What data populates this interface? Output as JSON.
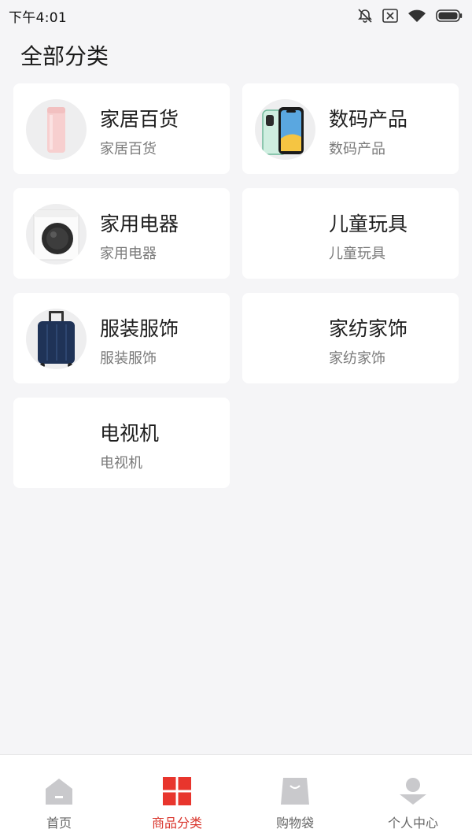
{
  "status_bar": {
    "time": "下午4:01",
    "icons": [
      "mute-icon",
      "sim-off-icon",
      "wifi-icon",
      "battery-icon"
    ]
  },
  "page": {
    "title": "全部分类"
  },
  "categories": [
    {
      "title": "家居百货",
      "subtitle": "家居百货",
      "image": "thermos-cup"
    },
    {
      "title": "数码产品",
      "subtitle": "数码产品",
      "image": "smartphone"
    },
    {
      "title": "家用电器",
      "subtitle": "家用电器",
      "image": "washing-machine"
    },
    {
      "title": "儿童玩具",
      "subtitle": "儿童玩具",
      "image": ""
    },
    {
      "title": "服装服饰",
      "subtitle": "服装服饰",
      "image": "suitcase"
    },
    {
      "title": "家纺家饰",
      "subtitle": "家纺家饰",
      "image": ""
    },
    {
      "title": "电视机",
      "subtitle": "电视机",
      "image": ""
    }
  ],
  "tabbar": {
    "active_index": 1,
    "active_color": "#d9342b",
    "inactive_color": "#c9c9cc",
    "tabs": [
      {
        "label": "首页",
        "icon": "home-icon"
      },
      {
        "label": "商品分类",
        "icon": "category-grid-icon"
      },
      {
        "label": "购物袋",
        "icon": "shopping-bag-icon"
      },
      {
        "label": "个人中心",
        "icon": "user-icon"
      }
    ]
  }
}
